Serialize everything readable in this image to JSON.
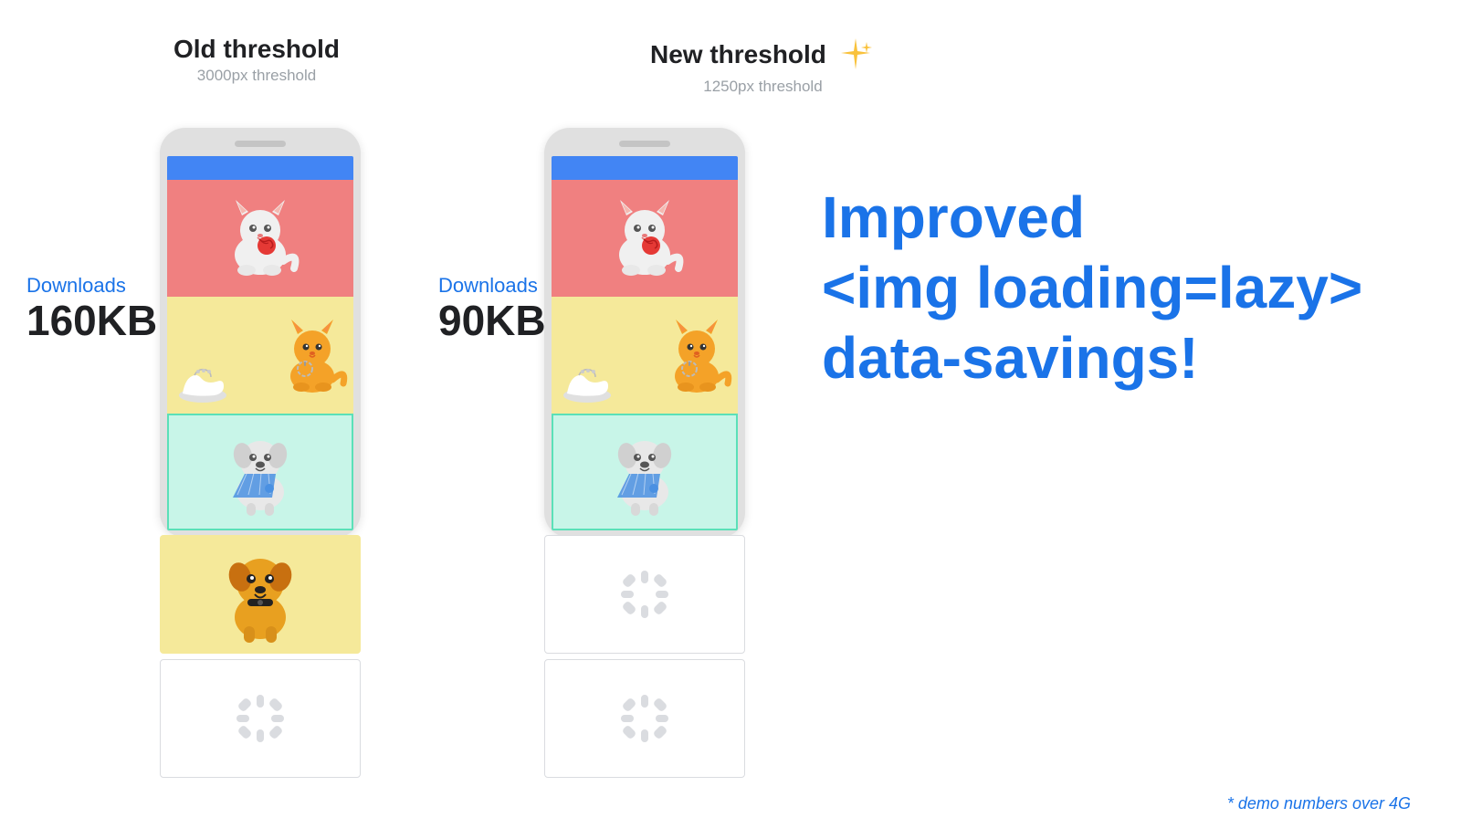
{
  "old_threshold": {
    "title": "Old threshold",
    "subtitle": "3000px threshold",
    "downloads_label": "Downloads",
    "downloads_value": "160KB"
  },
  "new_threshold": {
    "title": "New threshold",
    "subtitle": "1250px threshold",
    "downloads_label": "Downloads",
    "downloads_value": "90KB"
  },
  "description": {
    "line1": "Improved",
    "line2": "<img loading=lazy>",
    "line3": "data-savings!"
  },
  "demo_note": "* demo numbers over 4G",
  "sparkle": "✦"
}
